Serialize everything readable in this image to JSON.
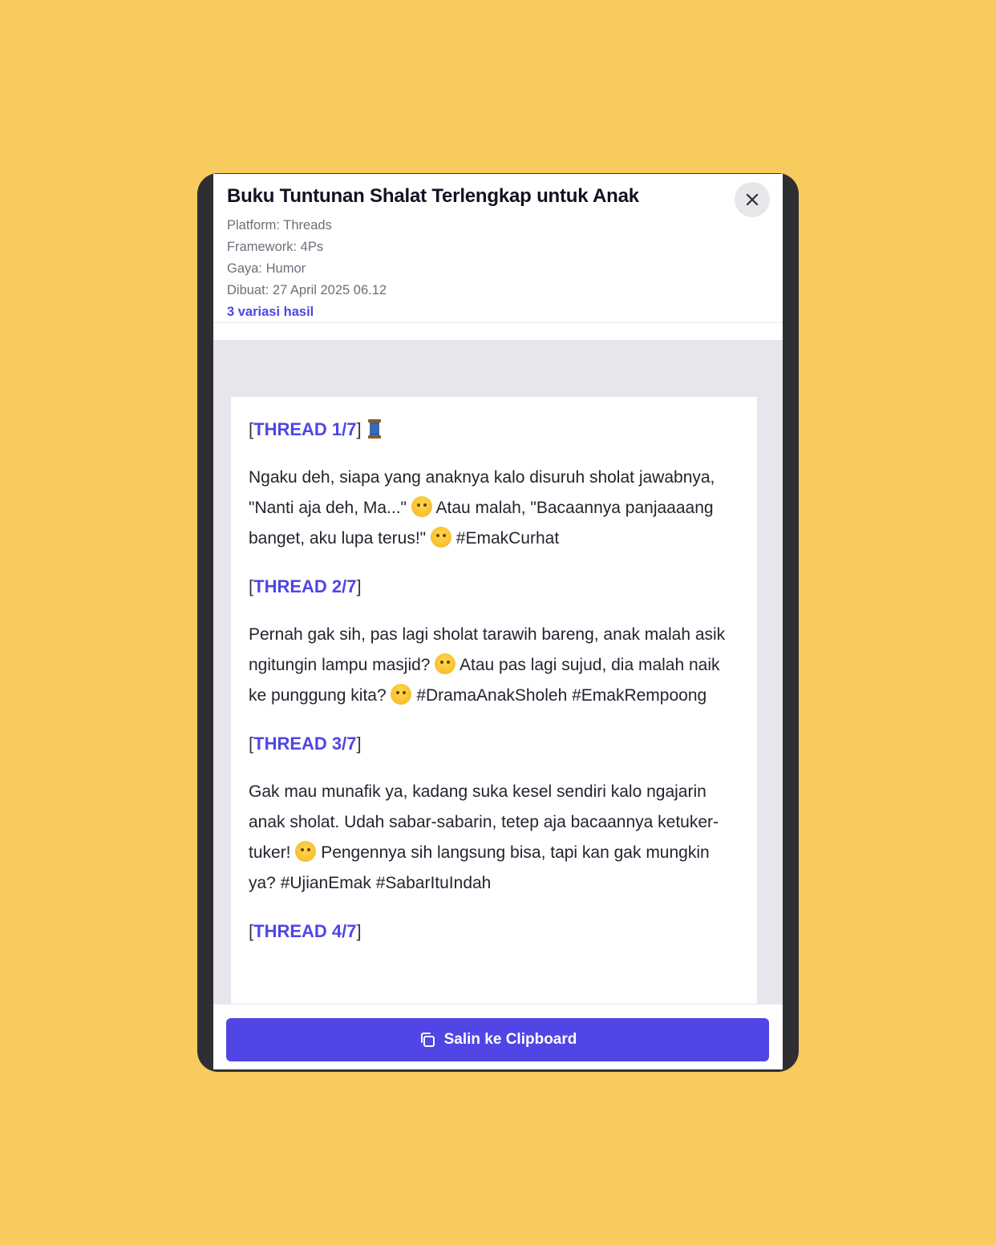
{
  "modal": {
    "title": "Buku Tuntunan Shalat Terlengkap untuk Anak",
    "platform": "Platform: Threads",
    "framework": "Framework: 4Ps",
    "style": "Gaya: Humor",
    "created": "Dibuat: 27 April 2025 06.12",
    "variants": "3 variasi hasil",
    "close_icon": "close-icon"
  },
  "threads": [
    {
      "open": "[",
      "label": "THREAD 1/7",
      "close": "]",
      "icon": "spool-of-thread-icon",
      "text_parts": [
        "Ngaku deh, siapa yang anaknya kalo disuruh sholat jawabnya, \"Nanti aja deh, Ma...\" ",
        " Atau malah, \"Bacaannya panjaaaang banget, aku lupa terus!\" ",
        " #EmakCurhat"
      ]
    },
    {
      "open": "[",
      "label": "THREAD 2/7",
      "close": "]",
      "text_parts": [
        "Pernah gak sih, pas lagi sholat tarawih bareng, anak malah asik ngitungin lampu masjid? ",
        " Atau pas lagi sujud, dia malah naik ke punggung kita? ",
        " #DramaAnakSholeh #EmakRempoong"
      ]
    },
    {
      "open": "[",
      "label": "THREAD 3/7",
      "close": "]",
      "text_parts": [
        "Gak mau munafik ya, kadang suka kesel sendiri kalo ngajarin anak sholat. Udah sabar-sabarin, tetep aja bacaannya ketuker-tuker! ",
        " Pengennya sih langsung bisa, tapi kan gak mungkin ya? #UjianEmak #SabarItuIndah"
      ]
    },
    {
      "open": "[",
      "label": "THREAD 4/7",
      "close": "]"
    }
  ],
  "footer": {
    "copy_label": "Salin ke Clipboard",
    "copy_icon": "copy-icon"
  },
  "colors": {
    "background": "#f7cb5e",
    "accent": "#4f46e5",
    "text": "#22252e"
  }
}
